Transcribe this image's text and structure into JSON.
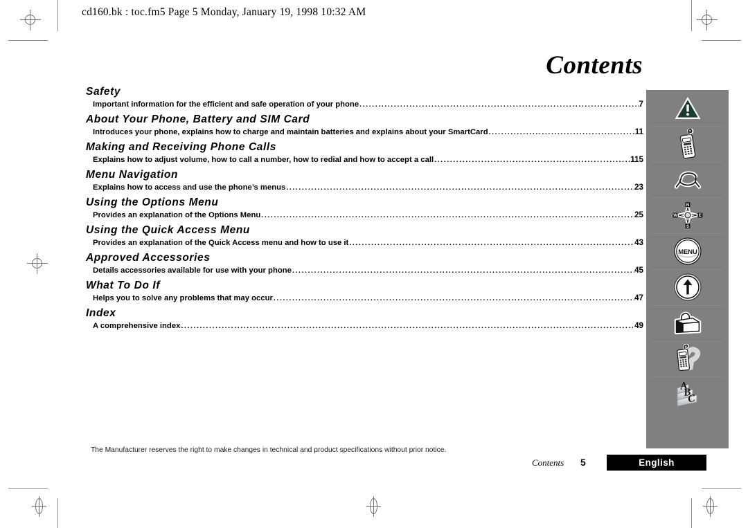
{
  "header": {
    "text": "cd160.bk : toc.fm5  Page 5  Monday, January 19, 1998  10:32 AM"
  },
  "title": "Contents",
  "toc": {
    "entries": [
      {
        "heading": "Safety",
        "description": "Important information for the efficient and safe operation of your phone",
        "page": "7"
      },
      {
        "heading": "About Your Phone, Battery and SIM Card",
        "description": "Introduces your phone, explains how to charge and maintain batteries and explains about your SmartCard",
        "page": "11"
      },
      {
        "heading": "Making and Receiving Phone Calls",
        "description": "Explains how to adjust volume, how to call a number, how to redial and how to accept a call",
        "page": "115"
      },
      {
        "heading": "Menu Navigation",
        "description": "Explains how to access and use the phone’s menus",
        "page": "23"
      },
      {
        "heading": "Using the Options Menu",
        "description": "Provides an explanation of the Options Menu",
        "page": "25"
      },
      {
        "heading": "Using the Quick Access Menu",
        "description": "Provides an explanation of the Quick Access menu and how to use it",
        "page": "43"
      },
      {
        "heading": "Approved Accessories",
        "description": "Details accessories available for use with your phone",
        "page": "45"
      },
      {
        "heading": "What To Do If",
        "description": "Helps you to solve any problems that may occur",
        "page": "47"
      },
      {
        "heading": "Index",
        "description": "A comprehensive index",
        "page": "49"
      }
    ]
  },
  "sidebar": {
    "background_color": "#808080",
    "tabs": [
      {
        "icon": "warning-triangle-icon",
        "section": "Safety"
      },
      {
        "icon": "mobile-phone-icon",
        "section": "About Your Phone, Battery and SIM Card"
      },
      {
        "icon": "ringing-phone-icon",
        "section": "Making and Receiving Phone Calls"
      },
      {
        "icon": "compass-navigation-icon",
        "section": "Menu Navigation"
      },
      {
        "icon": "menu-button-icon",
        "section": "Using the Options Menu",
        "label": "MENU"
      },
      {
        "icon": "up-arrow-circle-icon",
        "section": "Using the Quick Access Menu"
      },
      {
        "icon": "briefcase-accessories-icon",
        "section": "Approved Accessories"
      },
      {
        "icon": "phone-question-icon",
        "section": "What To Do If"
      },
      {
        "icon": "abc-index-icon",
        "section": "Index",
        "letters": [
          "A",
          "B",
          "C"
        ]
      }
    ]
  },
  "compass": {
    "north": "N",
    "west": "W",
    "east": "E",
    "south": "S"
  },
  "footer": {
    "disclaimer": "The Manufacturer reserves the right to make changes in technical and product specifications without prior notice.",
    "section_label": "Contents",
    "page_number": "5",
    "language_badge": "English",
    "badge_background": "#000000",
    "badge_text_color": "#ffffff"
  }
}
